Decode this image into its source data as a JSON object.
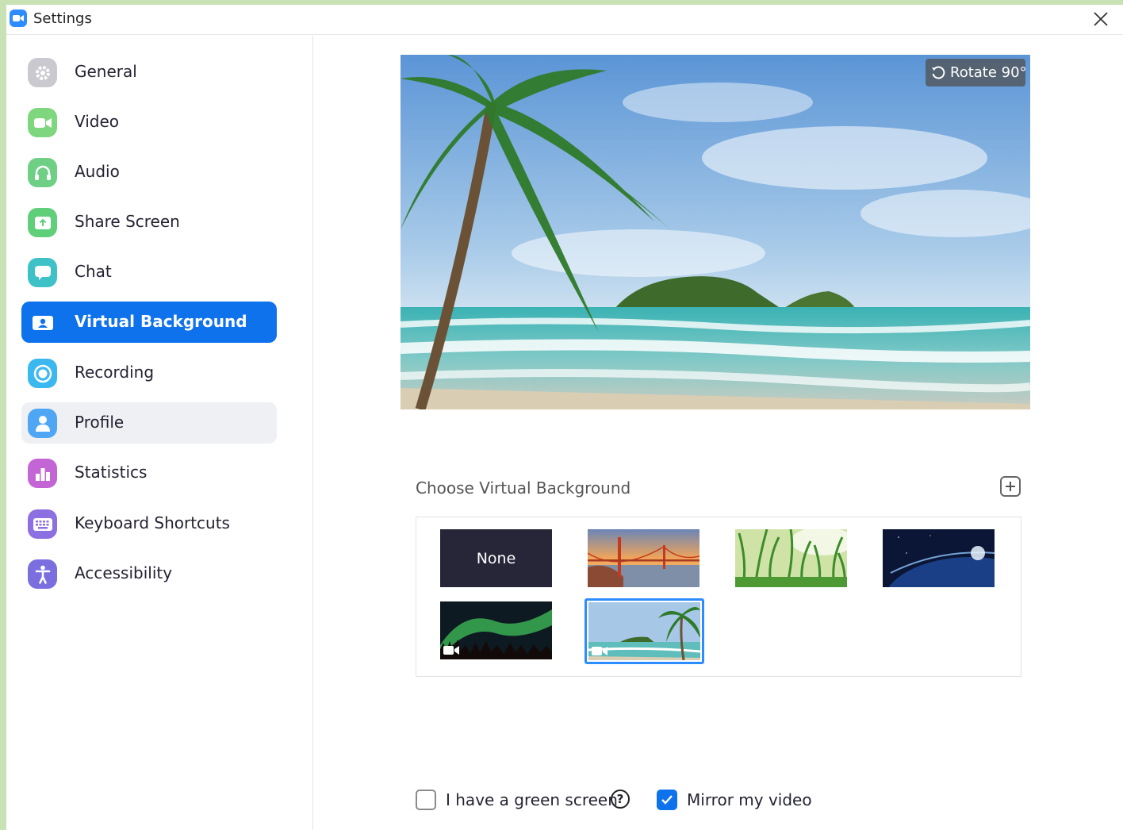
{
  "window": {
    "title": "Settings",
    "app_icon": "zoom-camera-icon",
    "close_icon": "close-x-icon"
  },
  "sidebar": {
    "items": [
      {
        "label": "General",
        "icon": "gear-icon",
        "color": "#c9c9cf",
        "state": "normal"
      },
      {
        "label": "Video",
        "icon": "video-camera-icon",
        "color": "#7ed67e",
        "state": "normal"
      },
      {
        "label": "Audio",
        "icon": "headphones-icon",
        "color": "#6fcf85",
        "state": "normal"
      },
      {
        "label": "Share Screen",
        "icon": "share-screen-icon",
        "color": "#5fcf7a",
        "state": "normal"
      },
      {
        "label": "Chat",
        "icon": "chat-bubble-icon",
        "color": "#3fc2c7",
        "state": "normal"
      },
      {
        "label": "Virtual Background",
        "icon": "portrait-icon",
        "color": "#0e72ed",
        "state": "active"
      },
      {
        "label": "Recording",
        "icon": "record-icon",
        "color": "#3bb8f0",
        "state": "normal"
      },
      {
        "label": "Profile",
        "icon": "person-icon",
        "color": "#4ea6f5",
        "state": "hover"
      },
      {
        "label": "Statistics",
        "icon": "bar-chart-icon",
        "color": "#c465d6",
        "state": "normal"
      },
      {
        "label": "Keyboard Shortcuts",
        "icon": "keyboard-icon",
        "color": "#8c6fe0",
        "state": "normal"
      },
      {
        "label": "Accessibility",
        "icon": "accessibility-icon",
        "color": "#7b6fe0",
        "state": "normal"
      }
    ]
  },
  "preview": {
    "rotate_label": "Rotate 90°",
    "rotate_icon": "rotate-icon",
    "scene": "tropical beach with palm tree"
  },
  "gallery": {
    "heading": "Choose Virtual Background",
    "add_icon": "plus-square-icon",
    "items": [
      {
        "label": "None",
        "kind": "none"
      },
      {
        "label": "",
        "kind": "golden-gate-bridge"
      },
      {
        "label": "",
        "kind": "grass"
      },
      {
        "label": "",
        "kind": "earth-from-space"
      },
      {
        "label": "",
        "kind": "aurora",
        "video": true
      },
      {
        "label": "",
        "kind": "beach",
        "video": true,
        "selected": true
      }
    ]
  },
  "options": {
    "green_screen": {
      "label": "I have a green screen",
      "checked": false
    },
    "mirror": {
      "label": "Mirror my video",
      "checked": true
    },
    "help_glyph": "?"
  },
  "colors": {
    "accent": "#0e72ed",
    "selection": "#2d8cff"
  }
}
